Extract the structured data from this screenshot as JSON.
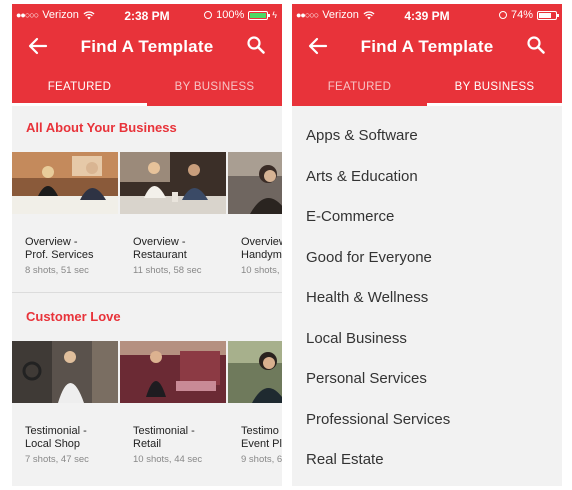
{
  "left_screen": {
    "status": {
      "carrier": "Verizon",
      "time": "2:38 PM",
      "battery": "100%"
    },
    "appbar": {
      "title": "Find A Template"
    },
    "tabs": [
      {
        "label": "FEATURED"
      },
      {
        "label": "BY BUSINESS"
      }
    ],
    "active_tab": 0,
    "sections": [
      {
        "title": "All About Your Business",
        "cards": [
          {
            "title_line1": "Overview -",
            "title_line2": "Prof. Services",
            "meta": "8 shots, 51 sec"
          },
          {
            "title_line1": "Overview -",
            "title_line2": "Restaurant",
            "meta": "11 shots, 58 sec"
          },
          {
            "title_line1": "Overview -",
            "title_line2": "Handym",
            "meta": "10 shots,"
          }
        ]
      },
      {
        "title": "Customer Love",
        "cards": [
          {
            "title_line1": "Testimonial -",
            "title_line2": "Local Shop",
            "meta": "7 shots, 47 sec"
          },
          {
            "title_line1": "Testimonial -",
            "title_line2": "Retail",
            "meta": "10 shots, 44 sec"
          },
          {
            "title_line1": "Testimo",
            "title_line2": "Event Pl",
            "meta": "9 shots, 6"
          }
        ]
      }
    ]
  },
  "right_screen": {
    "status": {
      "carrier": "Verizon",
      "time": "4:39 PM",
      "battery": "74%"
    },
    "appbar": {
      "title": "Find A Template"
    },
    "tabs": [
      {
        "label": "FEATURED"
      },
      {
        "label": "BY BUSINESS"
      }
    ],
    "active_tab": 1,
    "business_categories": [
      "Apps & Software",
      "Arts & Education",
      "E-Commerce",
      "Good for Everyone",
      "Health & Wellness",
      "Local Business",
      "Personal Services",
      "Professional Services",
      "Real Estate"
    ]
  },
  "colors": {
    "accent": "#e8333a",
    "background": "#f2f2f2",
    "battery_full": "#4cd964"
  },
  "icons": [
    "back-arrow-icon",
    "search-icon",
    "wifi-icon",
    "alarm-icon",
    "battery-icon",
    "signal-dots-icon"
  ]
}
